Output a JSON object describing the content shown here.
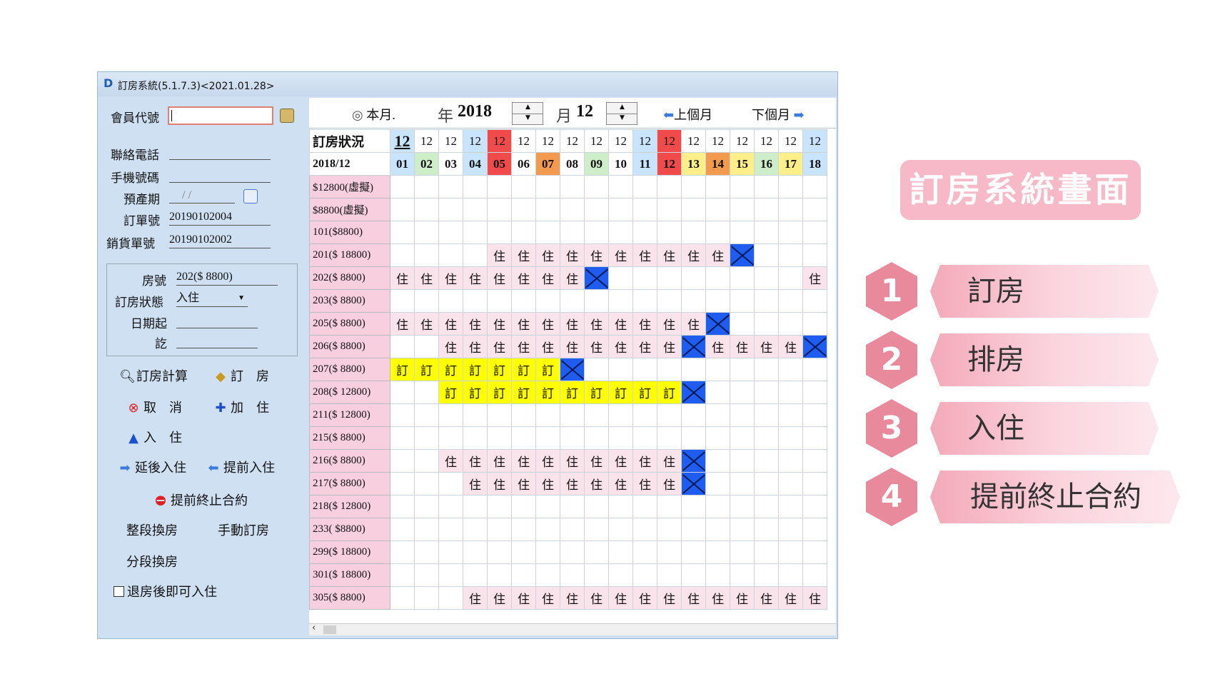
{
  "window": {
    "title": "訂房系統(5.1.7.3)<2021.01.28>"
  },
  "left": {
    "member_label": "會員代號",
    "phone_label": "聯絡電話",
    "mobile_label": "手機號碼",
    "due_label": "預產期",
    "due_value": "/ /",
    "order_label": "訂單號",
    "order_value": "20190102004",
    "sales_label": "銷貨單號",
    "sales_value": "20190102002",
    "room_label": "房號",
    "room_value": "202($ 8800)",
    "status_label": "訂房狀態",
    "status_value": "入住",
    "date_from_label": "日期起",
    "date_to_label": "訖",
    "buttons": {
      "calc": "訂房計算",
      "book": "訂　房",
      "cancel": "取　消",
      "add_stay": "加　住",
      "checkin": "入　住",
      "delay": "延後入住",
      "early": "提前入住",
      "terminate": "提前終止合約",
      "full_change": "整段換房",
      "manual": "手動訂房",
      "part_change": "分段換房",
      "checkout_label": "退房後即可入住"
    }
  },
  "toolbar": {
    "this_month": "本月.",
    "year_label": "年",
    "year_value": "2018",
    "month_label": "月",
    "month_value": "12",
    "prev": "上個月",
    "next": "下個月"
  },
  "grid": {
    "header_label": "訂房狀況",
    "month_label": "2018/12",
    "months": [
      "12",
      "12",
      "12",
      "12",
      "12",
      "12",
      "12",
      "12",
      "12",
      "12",
      "12",
      "12",
      "12",
      "12",
      "12",
      "12",
      "12",
      "12"
    ],
    "days": [
      "01",
      "02",
      "03",
      "04",
      "05",
      "06",
      "07",
      "08",
      "09",
      "10",
      "11",
      "12",
      "13",
      "14",
      "15",
      "16",
      "17",
      "18"
    ],
    "live": "住",
    "book": "訂",
    "rows": [
      {
        "label": "$12800(虛擬)",
        "cells": []
      },
      {
        "label": "$8800(虛擬)",
        "cells": []
      },
      {
        "label": "101($8800)",
        "cells": []
      },
      {
        "label": "201($ 18800)",
        "cells": [
          "",
          "",
          "",
          "",
          "L",
          "L",
          "L",
          "L",
          "L",
          "L",
          "L",
          "L",
          "L",
          "L",
          "X",
          "",
          "",
          ""
        ]
      },
      {
        "label": "202($ 8800)",
        "cells": [
          "L",
          "L",
          "L",
          "L",
          "L",
          "L",
          "L",
          "L",
          "X",
          "",
          "",
          "",
          "",
          "",
          "",
          "",
          "",
          "L"
        ]
      },
      {
        "label": "203($ 8800)",
        "cells": []
      },
      {
        "label": "205($ 8800)",
        "cells": [
          "L",
          "L",
          "L",
          "L",
          "L",
          "L",
          "L",
          "L",
          "L",
          "L",
          "L",
          "L",
          "L",
          "X",
          "",
          "",
          "",
          ""
        ]
      },
      {
        "label": "206($ 8800)",
        "cells": [
          "",
          "",
          "L",
          "L",
          "L",
          "L",
          "L",
          "L",
          "L",
          "L",
          "L",
          "L",
          "X",
          "L",
          "L",
          "L",
          "L",
          "X"
        ]
      },
      {
        "label": "207($ 8800)",
        "cells": [
          "B",
          "B",
          "B",
          "B",
          "B",
          "B",
          "B",
          "X",
          "",
          "",
          "",
          "",
          "",
          "",
          "",
          "",
          "",
          ""
        ]
      },
      {
        "label": "208($ 12800)",
        "cells": [
          "",
          "",
          "B",
          "B",
          "B",
          "B",
          "B",
          "B",
          "B",
          "B",
          "B",
          "B",
          "X",
          "",
          "",
          "",
          "",
          ""
        ]
      },
      {
        "label": "211($ 12800)",
        "cells": []
      },
      {
        "label": "215($ 8800)",
        "cells": []
      },
      {
        "label": "216($ 8800)",
        "cells": [
          "",
          "",
          "L",
          "L",
          "L",
          "L",
          "L",
          "L",
          "L",
          "L",
          "L",
          "L",
          "X",
          "",
          "",
          "",
          "",
          ""
        ]
      },
      {
        "label": "217($ 8800)",
        "cells": [
          "",
          "",
          "",
          "L",
          "L",
          "L",
          "L",
          "L",
          "L",
          "L",
          "L",
          "L",
          "X",
          "",
          "",
          "",
          "",
          ""
        ]
      },
      {
        "label": "218($ 12800)",
        "cells": []
      },
      {
        "label": "233( $8800)",
        "cells": []
      },
      {
        "label": "299($ 18800)",
        "cells": []
      },
      {
        "label": "301($ 18800)",
        "cells": []
      },
      {
        "label": "305($ 8800)",
        "cells": [
          "",
          "",
          "",
          "L",
          "L",
          "L",
          "L",
          "L",
          "L",
          "L",
          "L",
          "L",
          "L",
          "L",
          "L",
          "L",
          "L",
          "L"
        ]
      }
    ]
  },
  "side": {
    "title": "訂房系統畫面",
    "steps": [
      {
        "num": "1",
        "label": "訂房"
      },
      {
        "num": "2",
        "label": "排房"
      },
      {
        "num": "3",
        "label": "入住"
      },
      {
        "num": "4",
        "label": "提前終止合約"
      }
    ]
  },
  "colors": {
    "window_bg": "#cfe0f3",
    "room_label_bg": "#f7cfdf",
    "live_bg": "#fbe3ec",
    "book_bg": "#ffff00",
    "x_bg": "#1f5cf0",
    "accent_pink": "#f7b8c7",
    "hex_pink": "#e88a9c"
  }
}
